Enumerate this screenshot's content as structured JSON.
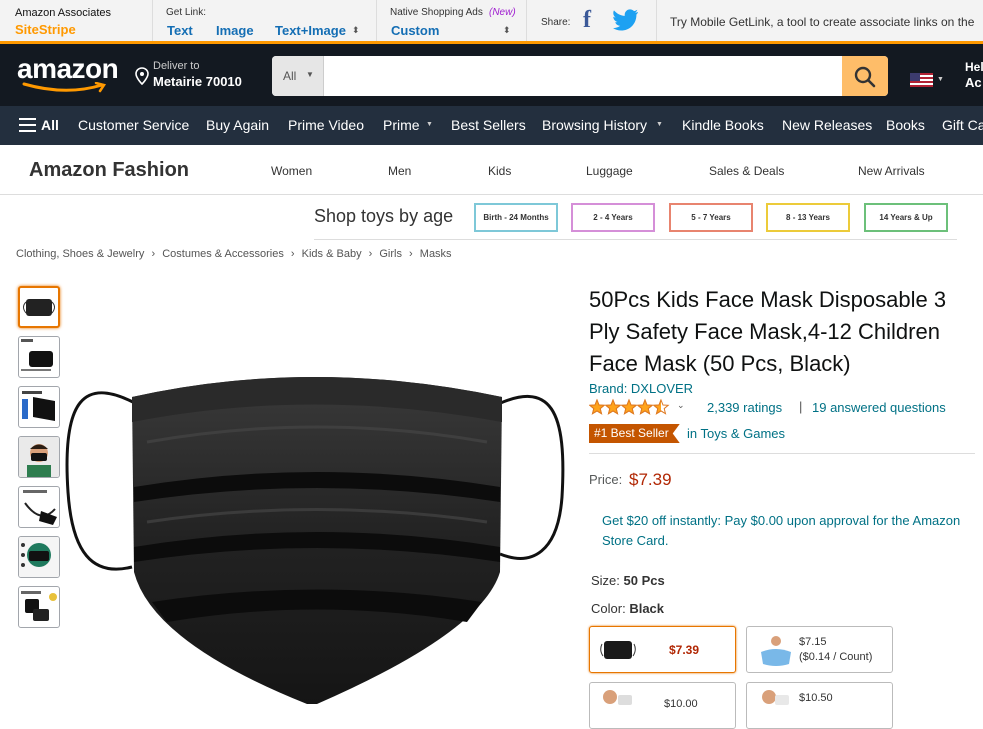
{
  "sitestripe": {
    "brand_top": "Amazon Associates",
    "brand_bottom": "SiteStripe",
    "get_link_label": "Get Link:",
    "text_link": "Text",
    "image_link": "Image",
    "text_image_link": "Text+Image",
    "native_label": "Native Shopping Ads",
    "native_new": "(New)",
    "custom_link": "Custom",
    "share_label": "Share:",
    "mobile_text": "Try Mobile GetLink, a tool to create associate links on the"
  },
  "header": {
    "logo": "amazon",
    "deliver_top": "Deliver to",
    "deliver_bottom": "Metairie 70010",
    "search_dept": "All",
    "search_placeholder": "",
    "hello_top": "Hel",
    "hello_bottom": "Ac"
  },
  "nav": {
    "all": "All",
    "items": [
      "Customer Service",
      "Buy Again",
      "Prime Video",
      "Prime",
      "Best Sellers",
      "Browsing History",
      "Kindle Books",
      "New Releases",
      "Books",
      "Gift Ca"
    ]
  },
  "fashion": {
    "title": "Amazon Fashion",
    "cats": [
      "Women",
      "Men",
      "Kids",
      "Luggage",
      "Sales & Deals",
      "New Arrivals"
    ]
  },
  "toys": {
    "title": "Shop toys by age",
    "ages": [
      "Birth - 24 Months",
      "2 - 4 Years",
      "5 - 7 Years",
      "8 - 13 Years",
      "14 Years & Up"
    ],
    "colors": [
      "#7ec8d8",
      "#d58fd8",
      "#e8846f",
      "#eccb3a",
      "#6cc07a"
    ]
  },
  "breadcrumb": [
    "Clothing, Shoes & Jewelry",
    "Costumes & Accessories",
    "Kids & Baby",
    "Girls",
    "Masks"
  ],
  "product": {
    "title": "50Pcs Kids Face Mask Disposable 3 Ply Safety Face Mask,4-12 Children Face Mask (50 Pcs, Black)",
    "brand": "Brand: DXLOVER",
    "rating": 4.5,
    "ratings": "2,339 ratings",
    "questions": "19 answered questions",
    "best_seller": "#1 Best Seller",
    "best_seller_cat": "in Toys & Games",
    "price_label": "Price:",
    "price": "$7.39",
    "promo": "Get $20 off instantly: Pay $0.00 upon approval for the Amazon Store Card.",
    "size_label": "Size:",
    "size_value": "50 Pcs",
    "color_label": "Color:",
    "color_value": "Black",
    "swatches": [
      {
        "price": "$7.39",
        "sub": ""
      },
      {
        "price": "$7.15",
        "sub": "($0.14 / Count)"
      },
      {
        "price": "$10.00",
        "sub": ""
      },
      {
        "price": "$10.50",
        "sub": ""
      }
    ]
  },
  "colors": {
    "orange": "#ff9900",
    "link": "#007185",
    "price": "#b12704",
    "navy": "#131921",
    "nav2": "#232f3e"
  }
}
